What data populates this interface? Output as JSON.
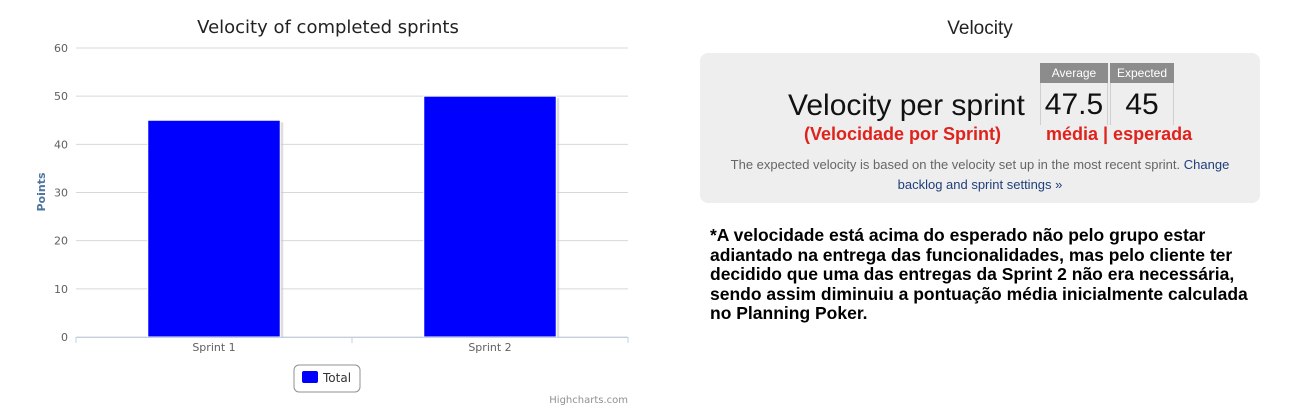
{
  "chart_data": {
    "type": "bar",
    "title": "Velocity of completed sprints",
    "categories": [
      "Sprint 1",
      "Sprint 2"
    ],
    "series": [
      {
        "name": "Total",
        "values": [
          45,
          50
        ],
        "color": "#0000ff"
      }
    ],
    "ylabel": "Points",
    "xlabel": "",
    "ylim": [
      0,
      60
    ],
    "yticks": [
      0,
      10,
      20,
      30,
      40,
      50,
      60
    ],
    "grid": true,
    "legend": "bottom-center",
    "credit": "Highcharts.com"
  },
  "velocity_panel": {
    "title": "Velocity",
    "label": "Velocity per sprint",
    "average_header": "Average",
    "expected_header": "Expected",
    "average_value": "47.5",
    "expected_value": "45",
    "annotation_label": "(Velocidade por Sprint)",
    "annotation_values": "média | esperada",
    "explanation": "The expected velocity is based on the velocity set up in the most recent sprint.",
    "link_text": "Change backlog and sprint settings »"
  },
  "note": "*A velocidade está acima do esperado não pelo grupo estar adiantado na entrega das funcionalidades, mas pelo cliente ter decidido que uma das entregas da Sprint 2 não era necessária, sendo assim diminuiu a pontuação média inicialmente calculada no Planning Poker.",
  "colors": {
    "bar": "#0000ff",
    "annotation": "#e0221c",
    "link": "#1f3f7a"
  }
}
